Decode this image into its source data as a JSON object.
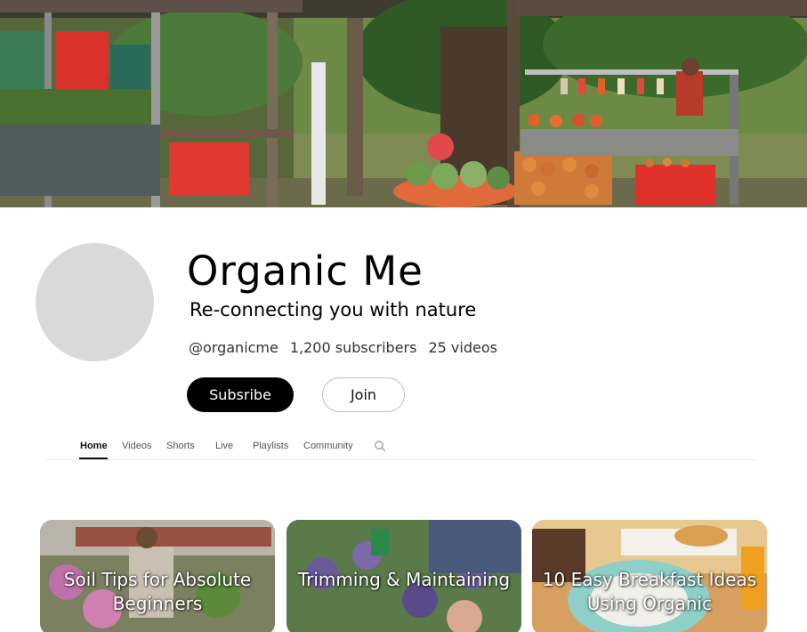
{
  "channel": {
    "name": "Organic Me",
    "tagline": "Re-connecting you with nature",
    "handle": "@organicme",
    "subscribers": "1,200 subscribers",
    "videos": "25 videos"
  },
  "actions": {
    "subscribe_label": "Subsribe",
    "join_label": "Join"
  },
  "tabs": [
    {
      "label": "Home",
      "active": true
    },
    {
      "label": "Videos"
    },
    {
      "label": "Shorts"
    },
    {
      "label": "Live"
    },
    {
      "label": "Playlists"
    },
    {
      "label": "Community"
    }
  ],
  "search_icon": "search-icon",
  "videos": [
    {
      "title": "Soil Tips for Absolute Beginners"
    },
    {
      "title": "Trimming & Maintaining"
    },
    {
      "title": "10 Easy Breakfast Ideas Using Organic"
    }
  ],
  "colors": {
    "subscribe_bg": "#000000",
    "subscribe_text": "#ffffff",
    "avatar_placeholder": "#d9d9d9"
  }
}
